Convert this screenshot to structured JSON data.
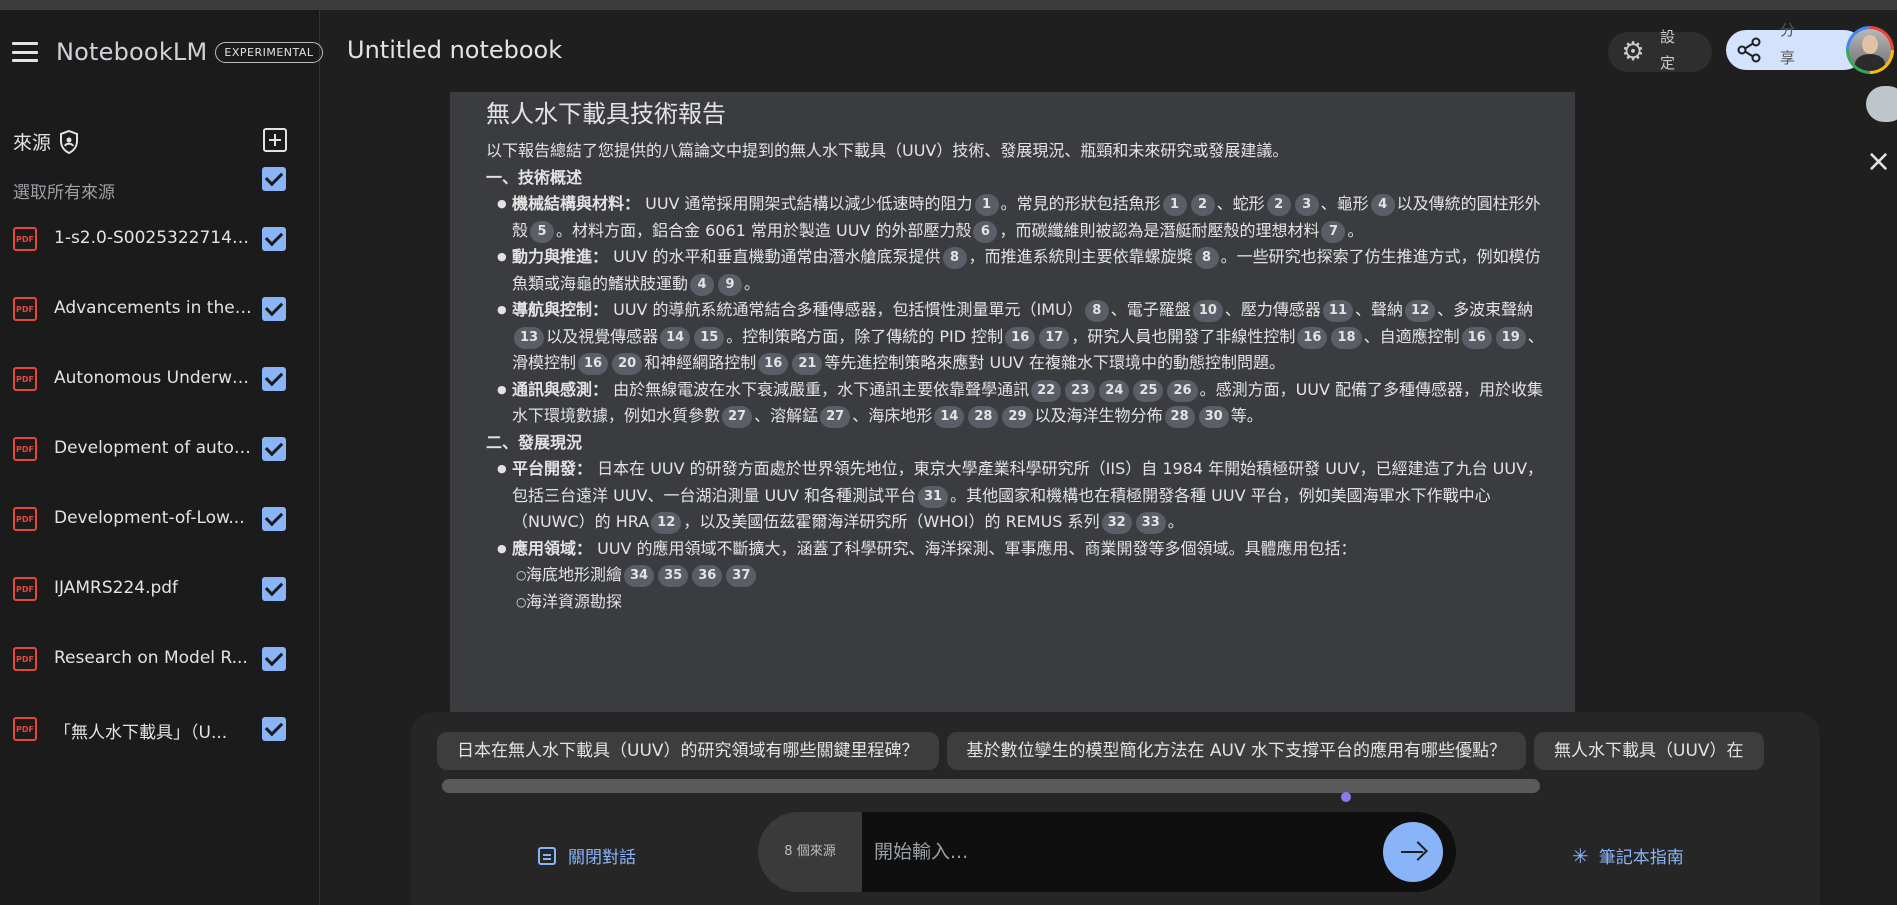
{
  "app": {
    "brand_name": "NotebookLM",
    "brand_tag": "EXPERIMENTAL",
    "notebook_title": "Untitled notebook"
  },
  "header": {
    "settings_label": "設定",
    "share_label": "分享"
  },
  "sidebar": {
    "sources_label": "來源",
    "select_all_label": "選取所有來源",
    "items": [
      {
        "name": "1-s2.0-S00253227140...",
        "type": "PDF"
      },
      {
        "name": "Advancements in the ...",
        "type": "PDF"
      },
      {
        "name": "Autonomous Underwa...",
        "type": "PDF"
      },
      {
        "name": "Development of auton...",
        "type": "PDF"
      },
      {
        "name": "Development-of-Low...",
        "type": "PDF"
      },
      {
        "name": "IJAMRS224.pdf",
        "type": "PDF"
      },
      {
        "name": "Research on Model R...",
        "type": "PDF"
      },
      {
        "name": "「無人水下載具」（U...",
        "type": "PDF"
      }
    ]
  },
  "report": {
    "title": "無人水下載具技術報告",
    "intro": "以下報告總結了您提供的八篇論文中提到的無人水下載具（UUV）技術、發展現況、瓶頸和未來研究或發展建議。",
    "section1": "一、技術概述",
    "section2": "二、發展現況",
    "mech_label": "機械結構與材料：",
    "drive_label": "動力與推進：",
    "nav_label": "導航與控制：",
    "comm_label": "通訊與感測：",
    "platform_label": "平台開發：",
    "app_label": "應用領域：",
    "seafloor_label": "海底地形測繪",
    "partial_label": "海洋資源勘探"
  },
  "chat": {
    "suggestions": [
      "日本在無人水下載具（UUV）的研究領域有哪些關鍵里程碑？",
      "基於數位孿生的模型簡化方法在 AUV 水下支撐平台的應用有哪些優點？",
      "無人水下載具（UUV）在"
    ],
    "close_chat_label": "關閉對話",
    "source_count": "8 個來源",
    "input_placeholder": "開始輸入...",
    "guide_label": "筆記本指南"
  },
  "colors": {
    "accent": "#8ab4f8",
    "pdf_red": "#e8453c",
    "background": "#1f1f1f"
  }
}
